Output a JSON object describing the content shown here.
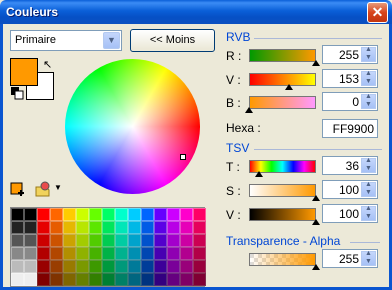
{
  "window": {
    "title": "Couleurs",
    "close": "✕"
  },
  "mode_select": {
    "value": "Primaire"
  },
  "toggle_button": {
    "label": "<< Moins"
  },
  "colors": {
    "primary": "#FF9900",
    "secondary": "#FFFFFF"
  },
  "rgb": {
    "title": "RVB",
    "r": {
      "label": "R :",
      "value": "255"
    },
    "g": {
      "label": "V :",
      "value": "153"
    },
    "b": {
      "label": "B :",
      "value": "0"
    },
    "hex": {
      "label": "Hexa :",
      "value": "FF9900"
    }
  },
  "hsv": {
    "title": "TSV",
    "h": {
      "label": "T :",
      "value": "36"
    },
    "s": {
      "label": "S :",
      "value": "100"
    },
    "v": {
      "label": "V :",
      "value": "100"
    }
  },
  "alpha": {
    "title": "Transparence - Alpha",
    "value": "255"
  }
}
